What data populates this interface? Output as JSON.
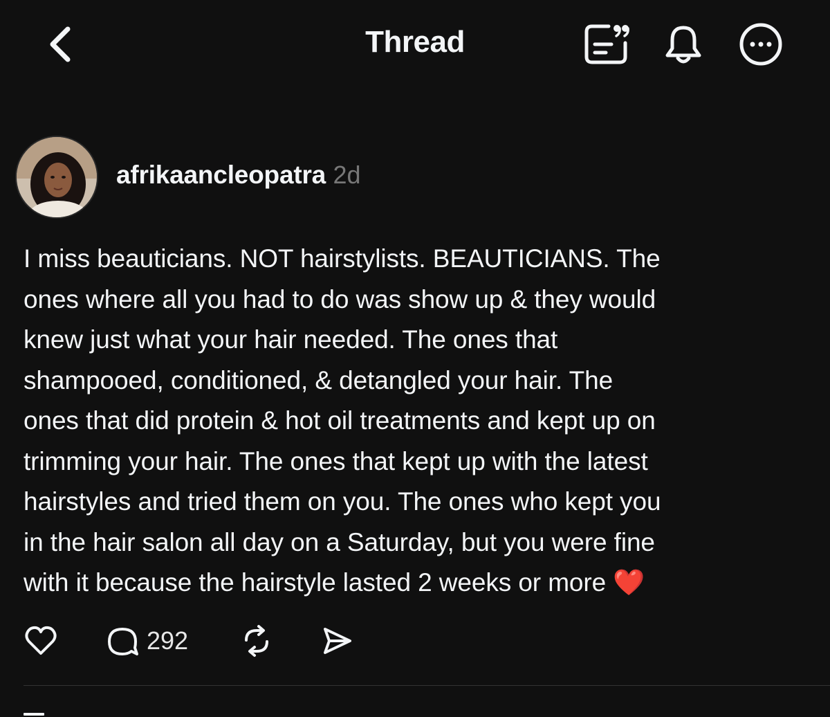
{
  "nav": {
    "title": "Thread",
    "icons": [
      "back-chevron-icon",
      "quote-post-icon",
      "notification-bell-icon",
      "more-options-icon"
    ]
  },
  "post": {
    "username": "afrikaancleopatra",
    "timestamp": "2d",
    "text": "I miss beauticians. NOT hairstylists. BEAUTICIANS. The\nones where all you had to do was show up & they would\nknew just what your hair needed. The ones that\nshampooed, conditioned, & detangled your hair. The\nones that did protein & hot oil treatments and kept up on\ntrimming your hair. The ones that kept up with the latest\nhairstyles and tried them on you. The ones who kept you\nin the hair salon all day on a Saturday, but you were fine\nwith it because the hairstyle lasted 2 weeks or more ❤️",
    "reply_count": "292",
    "action_icons": [
      "heart-icon",
      "reply-bubble-icon",
      "repost-icon",
      "share-send-icon"
    ]
  },
  "colors": {
    "background": "#101010",
    "text": "#f3f5f7",
    "secondary_text": "#777777",
    "divider": "#333333",
    "heart_emoji": "#e0212e"
  }
}
